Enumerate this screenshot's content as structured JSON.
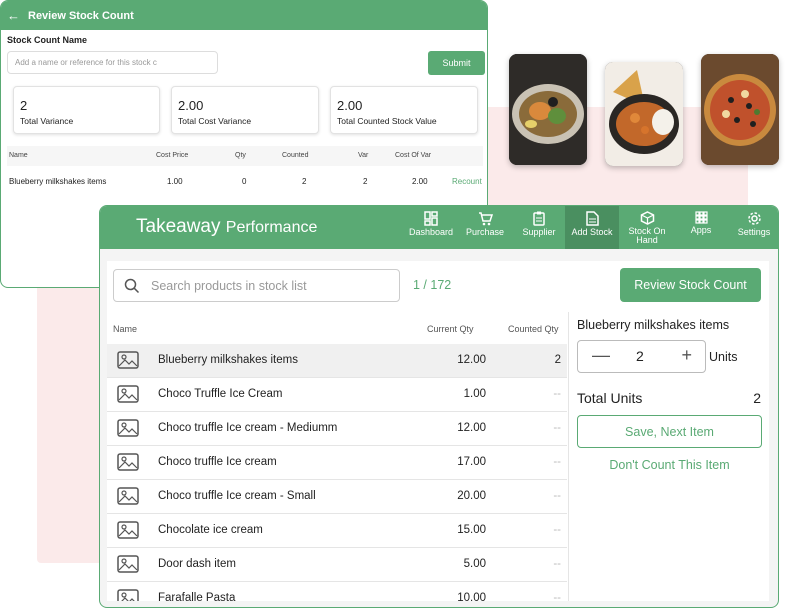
{
  "review_panel": {
    "title": "Review Stock Count",
    "name_label": "Stock Count Name",
    "name_placeholder": "Add a name or reference for this stock c",
    "submit_label": "Submit",
    "stats": [
      {
        "value": "2",
        "label": "Total Variance"
      },
      {
        "value": "2.00",
        "label": "Total Cost Variance"
      },
      {
        "value": "2.00",
        "label": "Total Counted Stock Value"
      }
    ],
    "columns": {
      "name": "Name",
      "cost_price": "Cost Price",
      "qty": "Qty",
      "counted": "Counted",
      "var": "Var",
      "cost_of_var": "Cost Of Var"
    },
    "rows": [
      {
        "name": "Blueberry  milkshakes items",
        "cost_price": "1.00",
        "qty": "0",
        "counted": "2",
        "var": "2",
        "cost_of_var": "2.00",
        "action": "Recount"
      }
    ]
  },
  "app": {
    "brand_1": "Takeaway",
    "brand_2": "Performance",
    "nav": [
      {
        "label": "Dashboard",
        "icon": "dashboard-icon"
      },
      {
        "label": "Purchase",
        "icon": "cart-icon"
      },
      {
        "label": "Supplier",
        "icon": "clipboard-icon"
      },
      {
        "label": "Add Stock",
        "icon": "document-icon",
        "active": true
      },
      {
        "label": "Stock On Hand",
        "icon": "boxes-icon"
      },
      {
        "label": "Apps",
        "icon": "grid-icon"
      },
      {
        "label": "Settings",
        "icon": "gear-icon"
      }
    ]
  },
  "stock": {
    "search_placeholder": "Search products in stock list",
    "count": "1 / 172",
    "review_button": "Review Stock Count",
    "columns": {
      "name": "Name",
      "current_qty": "Current Qty",
      "counted_qty": "Counted Qty"
    },
    "items": [
      {
        "name": "Blueberry  milkshakes items",
        "current_qty": "12.00",
        "counted_qty": "2"
      },
      {
        "name": "Choco Truffle Ice Cream",
        "current_qty": "1.00",
        "counted_qty": "--"
      },
      {
        "name": "Choco truffle Ice cream - Mediumm",
        "current_qty": "12.00",
        "counted_qty": "--"
      },
      {
        "name": "Choco truffle Ice cream",
        "current_qty": "17.00",
        "counted_qty": "--"
      },
      {
        "name": "Choco truffle Ice cream - Small",
        "current_qty": "20.00",
        "counted_qty": "--"
      },
      {
        "name": "Chocolate ice cream",
        "current_qty": "15.00",
        "counted_qty": "--"
      },
      {
        "name": "Door dash item",
        "current_qty": "5.00",
        "counted_qty": "--"
      },
      {
        "name": "Farafalle Pasta",
        "current_qty": "10.00",
        "counted_qty": "--"
      }
    ]
  },
  "detail": {
    "title": "Blueberry  milkshakes items",
    "quantity": "2",
    "units_label": "Units",
    "total_label": "Total Units",
    "total_value": "2",
    "save_label": "Save, Next Item",
    "skip_label": "Don't Count This Item"
  }
}
